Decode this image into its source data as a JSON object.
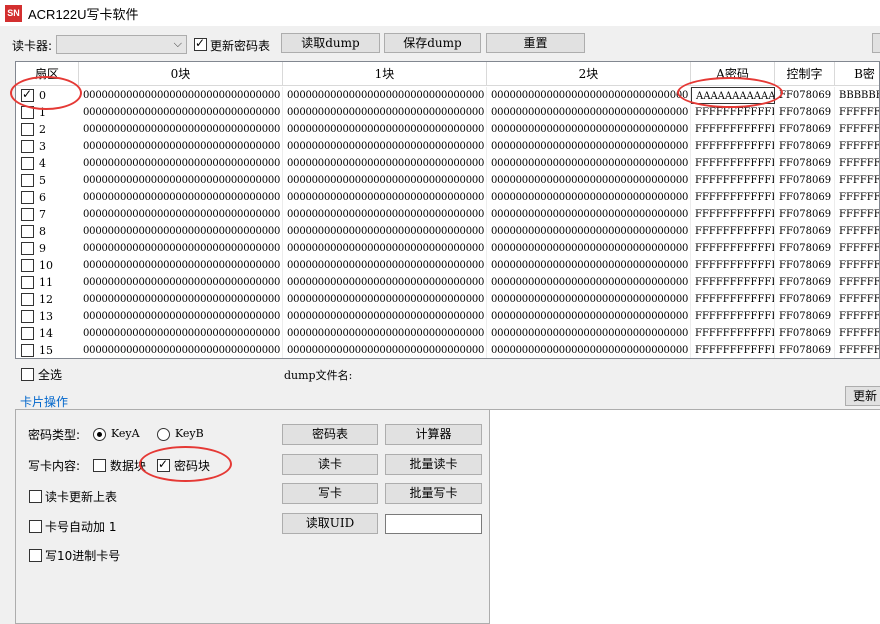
{
  "window": {
    "icon_text": "SN",
    "title": "ACR122U写卡软件"
  },
  "toolbar": {
    "reader_label": "读卡器:",
    "reader_value": "",
    "update_key_table_label": "更新密码表",
    "update_key_table_checked": true,
    "read_dump_label": "读取dump",
    "save_dump_label": "保存dump",
    "reset_label": "重置"
  },
  "grid": {
    "headers": [
      "扇区",
      "0块",
      "1块",
      "2块",
      "A密码",
      "控制字",
      "B密"
    ],
    "rows": [
      {
        "sector": "0",
        "checked": true,
        "b0": "00000000000000000000000000000000",
        "b1": "00000000000000000000000000000000",
        "b2": "00000000000000000000000000000000",
        "keyA": "AAAAAAAAAAAA",
        "ctrl": "FF078069",
        "keyB": "BBBBBBBB"
      },
      {
        "sector": "1",
        "checked": false,
        "b0": "00000000000000000000000000000000",
        "b1": "00000000000000000000000000000000",
        "b2": "00000000000000000000000000000000",
        "keyA": "FFFFFFFFFFFF",
        "ctrl": "FF078069",
        "keyB": "FFFFFFFF"
      },
      {
        "sector": "2",
        "checked": false,
        "b0": "00000000000000000000000000000000",
        "b1": "00000000000000000000000000000000",
        "b2": "00000000000000000000000000000000",
        "keyA": "FFFFFFFFFFFF",
        "ctrl": "FF078069",
        "keyB": "FFFFFFFF"
      },
      {
        "sector": "3",
        "checked": false,
        "b0": "00000000000000000000000000000000",
        "b1": "00000000000000000000000000000000",
        "b2": "00000000000000000000000000000000",
        "keyA": "FFFFFFFFFFFF",
        "ctrl": "FF078069",
        "keyB": "FFFFFFFF"
      },
      {
        "sector": "4",
        "checked": false,
        "b0": "00000000000000000000000000000000",
        "b1": "00000000000000000000000000000000",
        "b2": "00000000000000000000000000000000",
        "keyA": "FFFFFFFFFFFF",
        "ctrl": "FF078069",
        "keyB": "FFFFFFFF"
      },
      {
        "sector": "5",
        "checked": false,
        "b0": "00000000000000000000000000000000",
        "b1": "00000000000000000000000000000000",
        "b2": "00000000000000000000000000000000",
        "keyA": "FFFFFFFFFFFF",
        "ctrl": "FF078069",
        "keyB": "FFFFFFFF"
      },
      {
        "sector": "6",
        "checked": false,
        "b0": "00000000000000000000000000000000",
        "b1": "00000000000000000000000000000000",
        "b2": "00000000000000000000000000000000",
        "keyA": "FFFFFFFFFFFF",
        "ctrl": "FF078069",
        "keyB": "FFFFFFFF"
      },
      {
        "sector": "7",
        "checked": false,
        "b0": "00000000000000000000000000000000",
        "b1": "00000000000000000000000000000000",
        "b2": "00000000000000000000000000000000",
        "keyA": "FFFFFFFFFFFF",
        "ctrl": "FF078069",
        "keyB": "FFFFFFFF"
      },
      {
        "sector": "8",
        "checked": false,
        "b0": "00000000000000000000000000000000",
        "b1": "00000000000000000000000000000000",
        "b2": "00000000000000000000000000000000",
        "keyA": "FFFFFFFFFFFF",
        "ctrl": "FF078069",
        "keyB": "FFFFFFFF"
      },
      {
        "sector": "9",
        "checked": false,
        "b0": "00000000000000000000000000000000",
        "b1": "00000000000000000000000000000000",
        "b2": "00000000000000000000000000000000",
        "keyA": "FFFFFFFFFFFF",
        "ctrl": "FF078069",
        "keyB": "FFFFFFFF"
      },
      {
        "sector": "10",
        "checked": false,
        "b0": "00000000000000000000000000000000",
        "b1": "00000000000000000000000000000000",
        "b2": "00000000000000000000000000000000",
        "keyA": "FFFFFFFFFFFF",
        "ctrl": "FF078069",
        "keyB": "FFFFFFFF"
      },
      {
        "sector": "11",
        "checked": false,
        "b0": "00000000000000000000000000000000",
        "b1": "00000000000000000000000000000000",
        "b2": "00000000000000000000000000000000",
        "keyA": "FFFFFFFFFFFF",
        "ctrl": "FF078069",
        "keyB": "FFFFFFFF"
      },
      {
        "sector": "12",
        "checked": false,
        "b0": "00000000000000000000000000000000",
        "b1": "00000000000000000000000000000000",
        "b2": "00000000000000000000000000000000",
        "keyA": "FFFFFFFFFFFF",
        "ctrl": "FF078069",
        "keyB": "FFFFFFFF"
      },
      {
        "sector": "13",
        "checked": false,
        "b0": "00000000000000000000000000000000",
        "b1": "00000000000000000000000000000000",
        "b2": "00000000000000000000000000000000",
        "keyA": "FFFFFFFFFFFF",
        "ctrl": "FF078069",
        "keyB": "FFFFFFFF"
      },
      {
        "sector": "14",
        "checked": false,
        "b0": "00000000000000000000000000000000",
        "b1": "00000000000000000000000000000000",
        "b2": "00000000000000000000000000000000",
        "keyA": "FFFFFFFFFFFF",
        "ctrl": "FF078069",
        "keyB": "FFFFFFFF"
      },
      {
        "sector": "15",
        "checked": false,
        "b0": "00000000000000000000000000000000",
        "b1": "00000000000000000000000000000000",
        "b2": "00000000000000000000000000000000",
        "keyA": "FFFFFFFFFFFF",
        "ctrl": "FF078069",
        "keyB": "FFFFFFFF"
      }
    ]
  },
  "below_grid": {
    "select_all_label": "全选",
    "dump_filename_label": "dump文件名:",
    "update_button_label": "更新"
  },
  "card_ops": {
    "section_title": "卡片操作",
    "key_type_label": "密码类型:",
    "key_a_label": "KeyA",
    "key_b_label": "KeyB",
    "key_a_selected": true,
    "write_content_label": "写卡内容:",
    "data_block_label": "数据块",
    "data_block_checked": false,
    "key_block_label": "密码块",
    "key_block_checked": true,
    "read_update_table_label": "读卡更新上表",
    "auto_increment_label": "卡号自动加 1",
    "write_decimal_label": "写10进制卡号",
    "key_table_button": "密码表",
    "calculator_button": "计算器",
    "read_card_button": "读卡",
    "batch_read_button": "批量读卡",
    "write_card_button": "写卡",
    "batch_write_button": "批量写卡",
    "read_uid_button": "读取UID",
    "uid_value": ""
  },
  "colors": {
    "annotation_red": "#e53935",
    "section_title_blue": "#0066cc",
    "app_icon_red": "#d32f2f"
  }
}
